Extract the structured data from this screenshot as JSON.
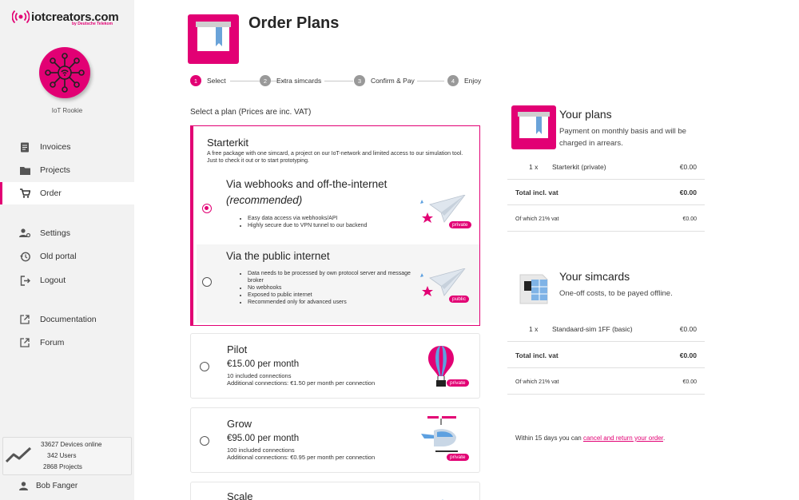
{
  "brand": {
    "name": "iotcreators.com",
    "sub": "by Deutsche Telekom",
    "accent": "#e20074"
  },
  "sidebar": {
    "rank": "IoT Rookie",
    "nav": [
      {
        "label": "Invoices",
        "icon": "invoice-icon"
      },
      {
        "label": "Projects",
        "icon": "folder-icon"
      },
      {
        "label": "Order",
        "icon": "cart-icon",
        "active": true
      },
      {
        "label": "Settings",
        "icon": "user-settings-icon"
      },
      {
        "label": "Old portal",
        "icon": "history-icon"
      },
      {
        "label": "Logout",
        "icon": "logout-icon"
      },
      {
        "label": "Documentation",
        "icon": "external-link-icon"
      },
      {
        "label": "Forum",
        "icon": "external-link-icon"
      }
    ],
    "stats": {
      "devices": "33627 Devices online",
      "users": "342 Users",
      "projects": "2868 Projects"
    },
    "user": "Bob Fanger"
  },
  "header": {
    "title": "Order Plans"
  },
  "steps": [
    {
      "num": "1",
      "label": "Select",
      "active": true
    },
    {
      "num": "2",
      "label": "Extra simcards"
    },
    {
      "num": "3",
      "label": "Confirm & Pay"
    },
    {
      "num": "4",
      "label": "Enjoy"
    }
  ],
  "select_label": "Select a plan (Prices are inc. VAT)",
  "plans": {
    "starterkit": {
      "title": "Starterkit",
      "description": "A free package with one simcard, a project on our IoT-network and limited access to our simulation tool. Just to check it out or to start prototyping.",
      "options": [
        {
          "title": "Via webhooks and off-the-internet",
          "subtitle": "(recommended)",
          "bullets": [
            "Easy data access via webhooks/API",
            "Highly secure due to VPN tunnel to our backend"
          ],
          "tag": "private",
          "selected": true
        },
        {
          "title": "Via the public internet",
          "bullets": [
            "Data needs to be processed by own protocol server and message broker",
            "No webhooks",
            "Exposed to public internet",
            "Recommended only for advanced users"
          ],
          "tag": "public",
          "selected": false
        }
      ]
    },
    "pilot": {
      "title": "Pilot",
      "price": "€15.00 per month",
      "connections": "10 included connections",
      "additional": "Additional connections: €1.50 per month per connection",
      "tag": "private"
    },
    "grow": {
      "title": "Grow",
      "price": "€95.00 per month",
      "connections": "100 included connections",
      "additional": "Additional connections: €0.95 per month per connection",
      "tag": "private"
    },
    "scale": {
      "title": "Scale"
    }
  },
  "your_plans": {
    "title": "Your plans",
    "description": "Payment on monthly basis and will be charged in arrears.",
    "line": {
      "qty": "1 x",
      "name": "Starterkit (private)",
      "amount": "€0.00"
    },
    "total_label": "Total incl. vat",
    "total": "€0.00",
    "vat_label": "Of which 21% vat",
    "vat": "€0.00"
  },
  "your_simcards": {
    "title": "Your simcards",
    "description": "One-off costs, to be payed offline.",
    "line": {
      "qty": "1 x",
      "name": "Standaard-sim 1FF (basic)",
      "amount": "€0.00"
    },
    "total_label": "Total incl. vat",
    "total": "€0.00",
    "vat_label": "Of which 21% vat",
    "vat": "€0.00"
  },
  "footnote": {
    "prefix": "Within 15 days you can ",
    "link": "cancel and return your order",
    "suffix": "."
  }
}
